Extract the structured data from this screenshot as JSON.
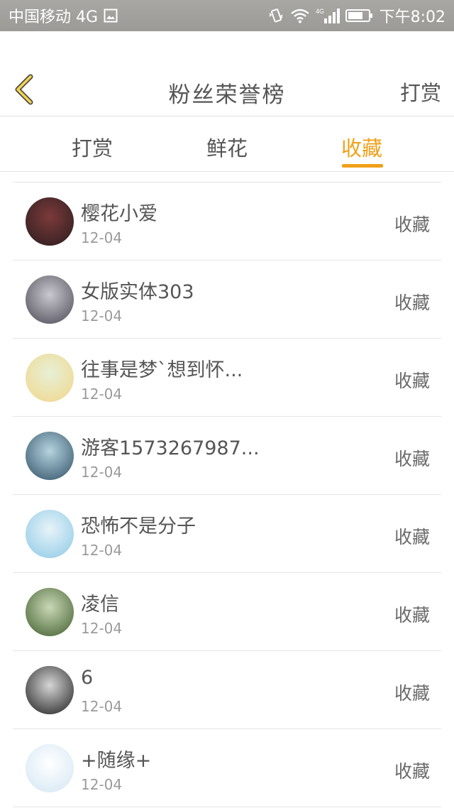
{
  "status_bar": {
    "carrier": "中国移动 4G",
    "time": "下午8:02",
    "network_badge": "4G"
  },
  "nav": {
    "title": "粉丝荣誉榜",
    "action": "打赏"
  },
  "tabs": [
    {
      "label": "打赏",
      "active": false
    },
    {
      "label": "鲜花",
      "active": false
    },
    {
      "label": "收藏",
      "active": true
    }
  ],
  "list": [
    {
      "name": "樱花小爱",
      "date": "12-04",
      "action": "收藏",
      "avatar_colors": [
        "#2a1d1f",
        "#7c3a3a"
      ]
    },
    {
      "name": "女版实体303",
      "date": "12-04",
      "action": "收藏",
      "avatar_colors": [
        "#4b4b55",
        "#c9c7cf"
      ]
    },
    {
      "name": "往事是梦ˋ想到怀...",
      "date": "12-04",
      "action": "收藏",
      "avatar_colors": [
        "#f2d68a",
        "#e6f0d6"
      ]
    },
    {
      "name": "游客1573267987...",
      "date": "12-04",
      "action": "收藏",
      "avatar_colors": [
        "#2f5066",
        "#b5d3df"
      ]
    },
    {
      "name": "恐怖不是分子",
      "date": "12-04",
      "action": "收藏",
      "avatar_colors": [
        "#8cc9e6",
        "#e7f3f8"
      ]
    },
    {
      "name": "凌信",
      "date": "12-04",
      "action": "收藏",
      "avatar_colors": [
        "#3f5d2c",
        "#c9d8b6"
      ]
    },
    {
      "name": "6",
      "date": "12-04",
      "action": "收藏",
      "avatar_colors": [
        "#1c1c1c",
        "#d6d6d6"
      ]
    },
    {
      "name": "+随缘+",
      "date": "12-04",
      "action": "收藏",
      "avatar_colors": [
        "#d3e6f3",
        "#ffffff"
      ]
    }
  ]
}
